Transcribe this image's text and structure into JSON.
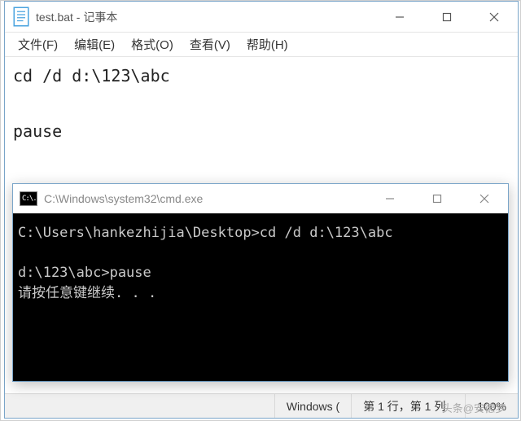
{
  "notepad": {
    "title": "test.bat - 记事本",
    "menu": {
      "file": "文件(F)",
      "edit": "编辑(E)",
      "format": "格式(O)",
      "view": "查看(V)",
      "help": "帮助(H)"
    },
    "content": "cd /d d:\\123\\abc\n\npause",
    "status": {
      "platform": "Windows (",
      "position": "第 1 行，第 1 列",
      "zoom": "100%"
    }
  },
  "cmd": {
    "title": "C:\\Windows\\system32\\cmd.exe",
    "icon_text": "C:\\.",
    "lines": [
      "C:\\Users\\hankezhijia\\Desktop>cd /d d:\\123\\abc",
      "",
      "d:\\123\\abc>pause",
      "请按任意键继续. . ."
    ]
  },
  "watermark": "头条@安德梦"
}
